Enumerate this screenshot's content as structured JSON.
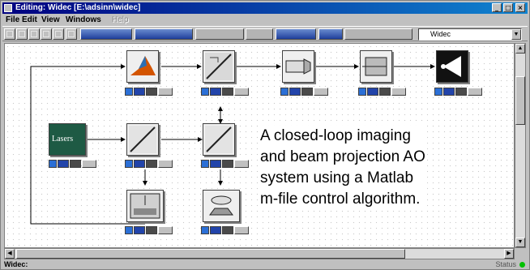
{
  "window": {
    "title": "Editing: Widec [E:\\adsinn\\widec]",
    "controls": [
      "minimize-icon",
      "maximize-icon",
      "close-icon"
    ]
  },
  "menu": {
    "items": [
      "File",
      "Edit",
      "View",
      "Windows"
    ],
    "disabled_item": "Help"
  },
  "toolbar": {
    "combo_value": "Widec"
  },
  "diagram": {
    "laser_label": "Lasers",
    "annotation_lines": [
      "A closed-loop imaging",
      "and beam projection AO",
      "system using a Matlab",
      "m-file control algorithm."
    ]
  },
  "status": {
    "left": "Widec:",
    "right": "Status"
  },
  "colors": {
    "titlebar": "#000080",
    "port_blue": "#2b6fd6",
    "led": "#00c000"
  }
}
